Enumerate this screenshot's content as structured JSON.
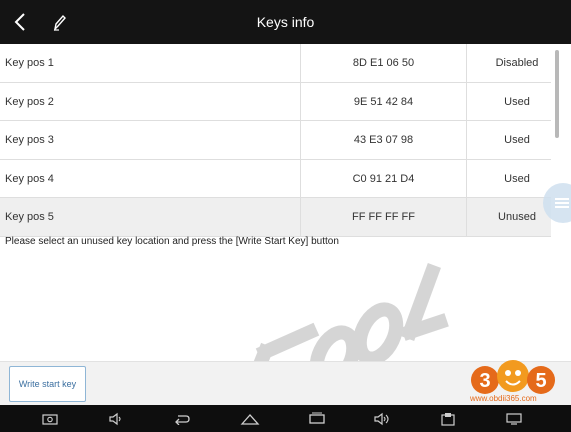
{
  "header": {
    "title": "Keys info",
    "back_icon": "back-chevron-icon",
    "edit_icon": "pen-icon"
  },
  "keys": [
    {
      "name": "Key pos 1",
      "code": "8D E1 06 50",
      "status": "Disabled"
    },
    {
      "name": "Key pos 2",
      "code": "9E 51 42 84",
      "status": "Used"
    },
    {
      "name": "Key pos 3",
      "code": "43 E3 07 98",
      "status": "Used"
    },
    {
      "name": "Key pos 4",
      "code": "C0 91 21 D4",
      "status": "Used"
    },
    {
      "name": "Key pos 5",
      "code": "FF FF FF FF",
      "status": "Unused"
    }
  ],
  "instruction": "Please select an unused key location and press the [Write Start Key] button",
  "actions": {
    "write_start_key": "Write start key"
  },
  "branding": {
    "watermark": "KTOOL",
    "logo_number": "365",
    "logo_url": "www.obdii365.com",
    "logo_color": "#e56a1a"
  },
  "navbar": {
    "icons": [
      "screenshot-icon",
      "volume-down-icon",
      "back-icon",
      "home-icon",
      "recent-apps-icon",
      "volume-up-icon",
      "app-icon",
      "window-icon"
    ]
  },
  "colors": {
    "topbar": "#141414",
    "navbar": "#0e0e0e",
    "button_border": "#8fb6d6"
  }
}
